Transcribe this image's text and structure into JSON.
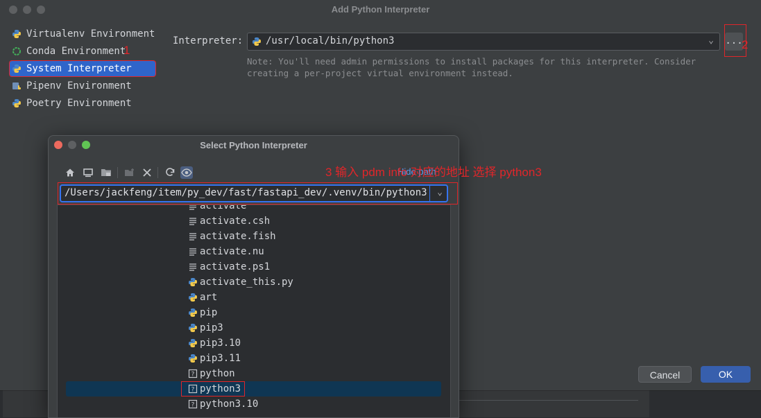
{
  "main": {
    "title": "Add Python Interpreter",
    "environments": [
      {
        "label": "Virtualenv Environment",
        "icon": "python-icon"
      },
      {
        "label": "Conda Environment",
        "icon": "conda-icon"
      },
      {
        "label": "System Interpreter",
        "icon": "python-icon",
        "selected": true
      },
      {
        "label": "Pipenv Environment",
        "icon": "pipenv-icon"
      },
      {
        "label": "Poetry Environment",
        "icon": "python-icon"
      }
    ],
    "interpreter_label": "Interpreter:",
    "interpreter_value": "/usr/local/bin/python3",
    "browse_label": "...",
    "note": "Note: You'll need admin permissions to install packages for this interpreter. Consider creating a per-project virtual environment instead.",
    "cancel_label": "Cancel",
    "ok_label": "OK"
  },
  "annotations": {
    "one": "1",
    "two": "2",
    "three": "3 输入 pdm info 对应的地址  选择 python3"
  },
  "dialog": {
    "title": "Select Python Interpreter",
    "hide_path_label": "Hide path",
    "path_value": "/Users/jackfeng/item/py_dev/fast/fastapi_dev/.venv/bin/python3",
    "files": [
      {
        "name": "activate",
        "icon": "text-file-icon"
      },
      {
        "name": "activate.csh",
        "icon": "text-file-icon"
      },
      {
        "name": "activate.fish",
        "icon": "text-file-icon"
      },
      {
        "name": "activate.nu",
        "icon": "text-file-icon"
      },
      {
        "name": "activate.ps1",
        "icon": "text-file-icon"
      },
      {
        "name": "activate_this.py",
        "icon": "python-icon"
      },
      {
        "name": "art",
        "icon": "python-icon"
      },
      {
        "name": "pip",
        "icon": "python-icon"
      },
      {
        "name": "pip3",
        "icon": "python-icon"
      },
      {
        "name": "pip3.10",
        "icon": "python-icon"
      },
      {
        "name": "pip3.11",
        "icon": "python-icon"
      },
      {
        "name": "python",
        "icon": "unknown-file-icon"
      },
      {
        "name": "python3",
        "icon": "unknown-file-icon",
        "selected": true
      },
      {
        "name": "python3.10",
        "icon": "unknown-file-icon"
      }
    ]
  },
  "colors": {
    "accent": "#3574f0",
    "annotation": "#e0262a",
    "selection": "#2f65ca"
  }
}
